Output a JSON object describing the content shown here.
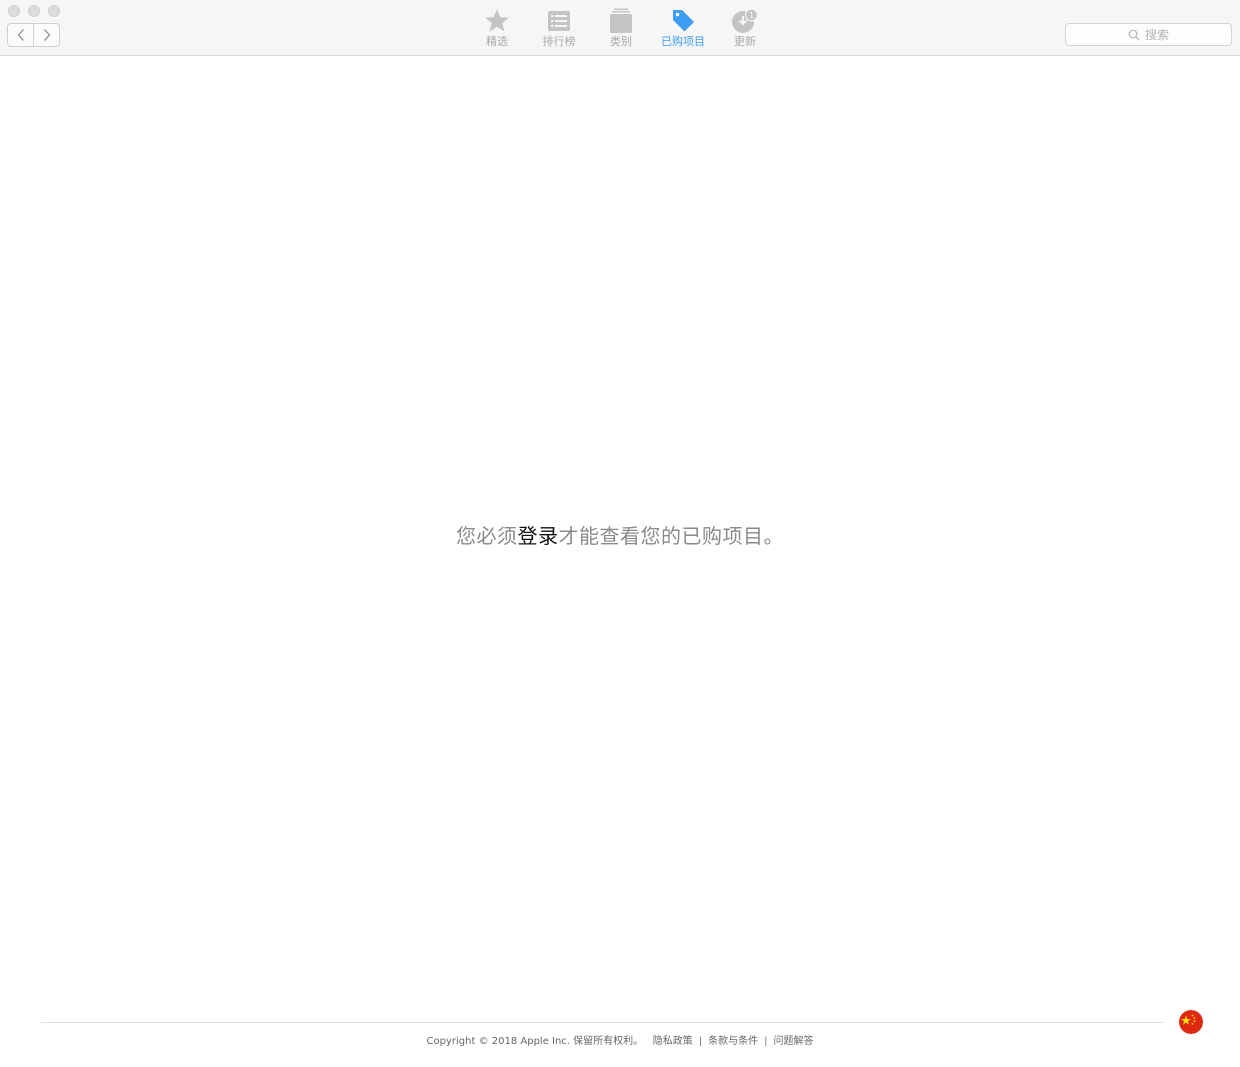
{
  "toolbar": {
    "tabs": [
      {
        "label": "精选",
        "icon": "star-icon",
        "active": false
      },
      {
        "label": "排行榜",
        "icon": "list-icon",
        "active": false
      },
      {
        "label": "类别",
        "icon": "stack-icon",
        "active": false
      },
      {
        "label": "已购项目",
        "icon": "tag-icon",
        "active": true
      },
      {
        "label": "更新",
        "icon": "update-icon",
        "active": false,
        "badge": "1"
      }
    ],
    "search": {
      "placeholder": "搜索"
    }
  },
  "main": {
    "message_before": "您必须",
    "login_link": "登录",
    "message_after": "才能查看您的已购项目。"
  },
  "footer": {
    "copyright": "Copyright © 2018 Apple Inc. 保留所有权利。",
    "links": [
      "隐私政策",
      "条款与条件",
      "问题解答"
    ],
    "separator": "|"
  },
  "colors": {
    "accent": "#3e9df2",
    "inactive_icon": "#c4c4c4",
    "flag_red": "#de2910",
    "flag_yellow": "#ffde00"
  }
}
